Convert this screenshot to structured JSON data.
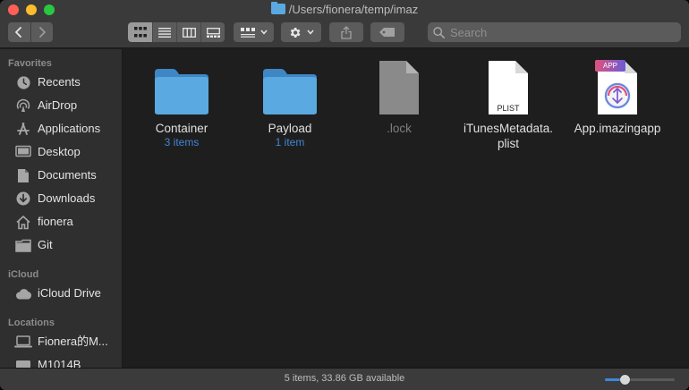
{
  "window": {
    "title": "/Users/fionera/temp/imaz"
  },
  "toolbar": {
    "back_icon": "chevron-left-icon",
    "forward_icon": "chevron-right-icon",
    "view_modes": [
      "icon-view",
      "list-view",
      "column-view",
      "gallery-view"
    ],
    "active_view": "icon-view",
    "search_placeholder": "Search"
  },
  "sidebar": {
    "favorites_header": "Favorites",
    "favorites": [
      {
        "label": "Recents",
        "icon": "clock-icon"
      },
      {
        "label": "AirDrop",
        "icon": "airdrop-icon"
      },
      {
        "label": "Applications",
        "icon": "applications-icon"
      },
      {
        "label": "Desktop",
        "icon": "desktop-icon"
      },
      {
        "label": "Documents",
        "icon": "document-icon"
      },
      {
        "label": "Downloads",
        "icon": "download-icon"
      },
      {
        "label": "fionera",
        "icon": "home-icon"
      },
      {
        "label": "Git",
        "icon": "folder-icon"
      }
    ],
    "icloud_header": "iCloud",
    "icloud": [
      {
        "label": "iCloud Drive",
        "icon": "cloud-icon"
      }
    ],
    "locations_header": "Locations",
    "locations": [
      {
        "label": "Fionera的M...",
        "icon": "laptop-icon"
      },
      {
        "label": "M1014B",
        "icon": "disk-icon"
      }
    ]
  },
  "files": [
    {
      "name": "Container",
      "sub": "3 items",
      "kind": "folder"
    },
    {
      "name": "Payload",
      "sub": "1 item",
      "kind": "folder"
    },
    {
      "name": ".lock",
      "sub": "",
      "kind": "generic-file"
    },
    {
      "name": "iTunesMetadata.\nplist",
      "sub": "",
      "kind": "plist",
      "badge": "PLIST"
    },
    {
      "name": "App.imazingapp",
      "sub": "",
      "kind": "imazing-app",
      "badge": "APP"
    }
  ],
  "status": {
    "text": "5 items, 33.86 GB available",
    "icon_size": 0.25
  },
  "colors": {
    "accent": "#3f86d8",
    "folder": "#5aa9e0",
    "close": "#fe5f57",
    "minimize": "#febc2e",
    "maximize": "#28c840"
  }
}
